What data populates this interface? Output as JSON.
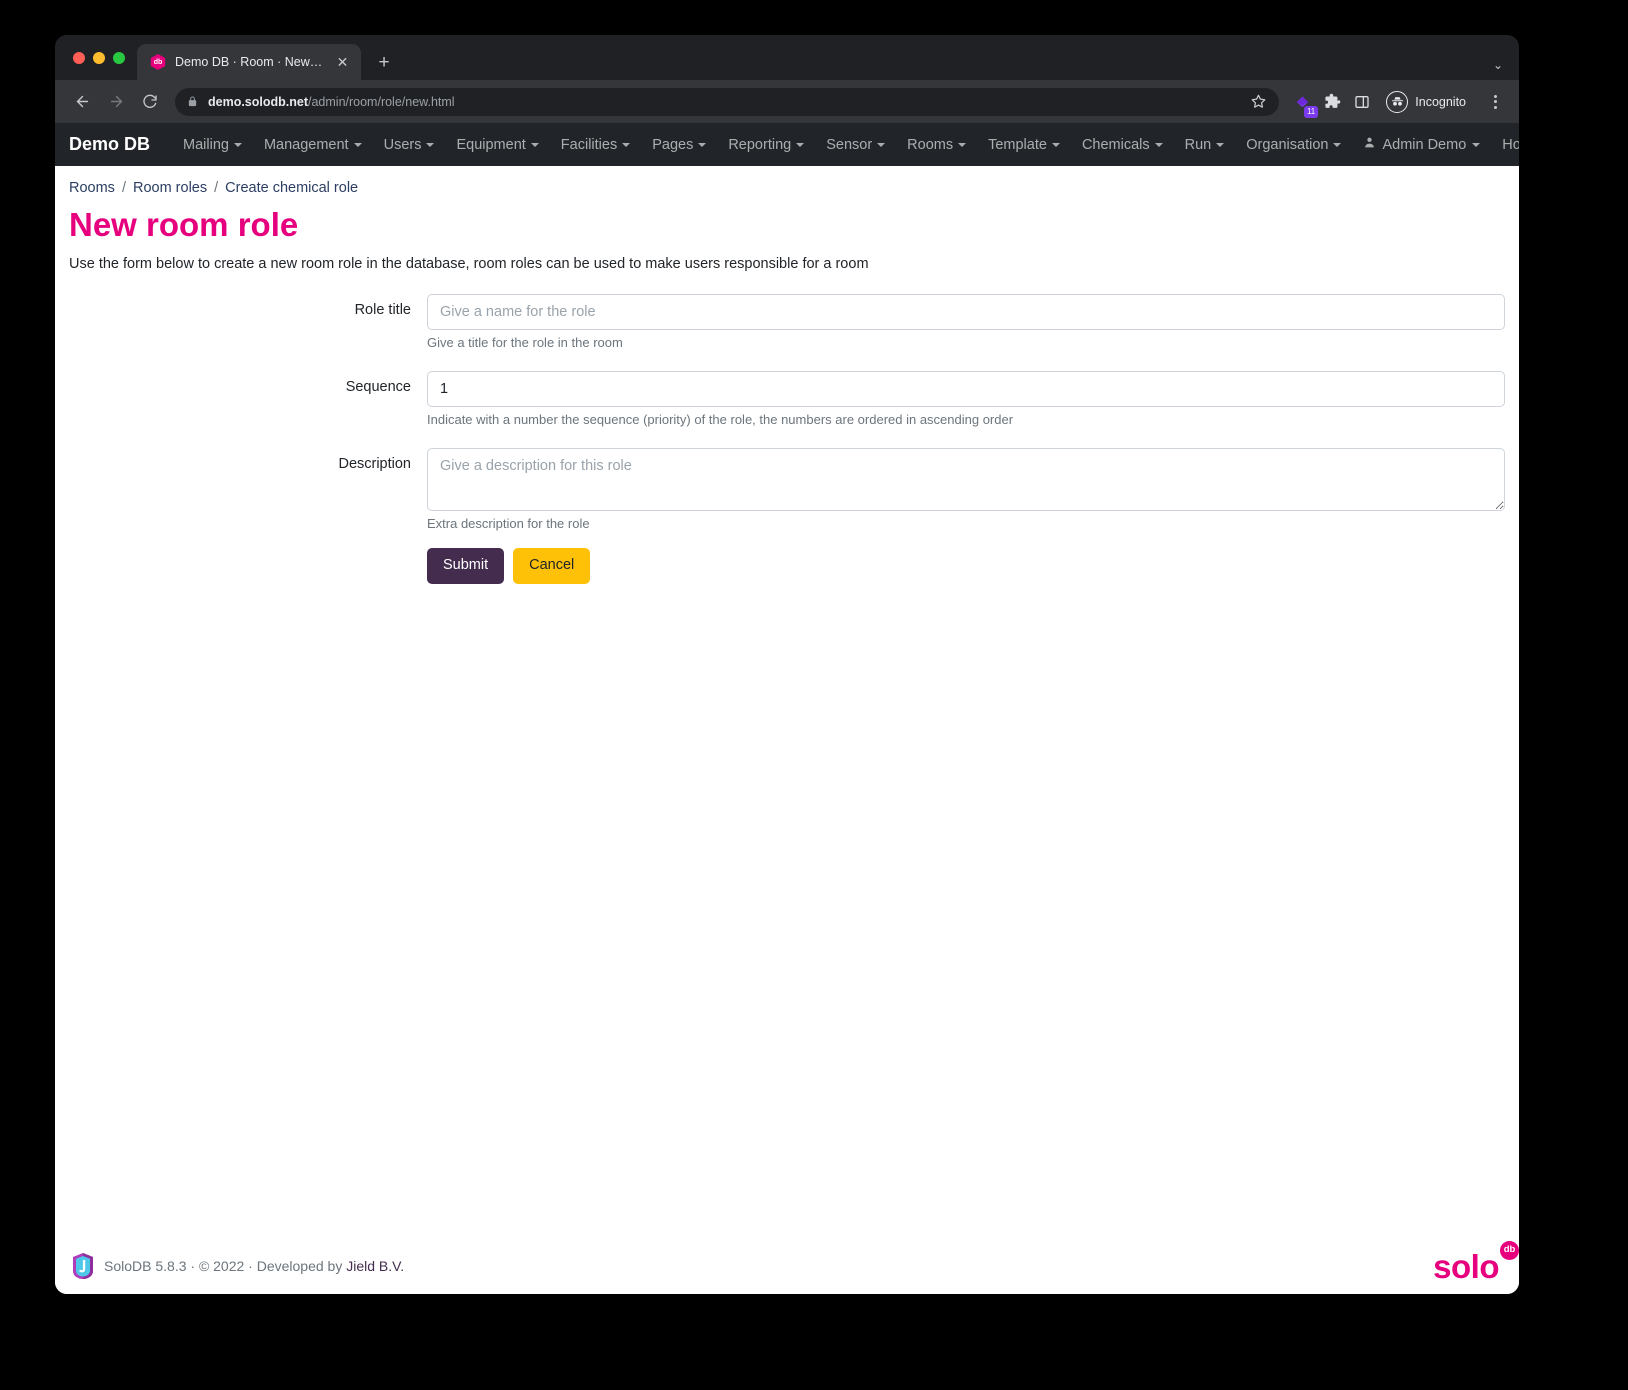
{
  "browser": {
    "tab": {
      "title": "Demo DB · Room · New role",
      "favicon_label": "db",
      "close_label": "✕"
    },
    "new_tab_label": "+",
    "tabstrip_chevron": "⌄",
    "address": {
      "domain": "demo.solodb.net",
      "path": "/admin/room/role/new.html",
      "lock_icon": "lock-icon",
      "star_icon": "bookmark-star-icon"
    },
    "extensions": {
      "badge_count": "11"
    },
    "profile_label": "Incognito",
    "menu_label": "⋮"
  },
  "navbar": {
    "brand": "Demo DB",
    "items": [
      {
        "label": "Mailing",
        "has_caret": true
      },
      {
        "label": "Management",
        "has_caret": true
      },
      {
        "label": "Users",
        "has_caret": true
      },
      {
        "label": "Equipment",
        "has_caret": true
      },
      {
        "label": "Facilities",
        "has_caret": true
      },
      {
        "label": "Pages",
        "has_caret": true
      },
      {
        "label": "Reporting",
        "has_caret": true
      },
      {
        "label": "Sensor",
        "has_caret": true
      },
      {
        "label": "Rooms",
        "has_caret": true
      },
      {
        "label": "Template",
        "has_caret": true
      },
      {
        "label": "Chemicals",
        "has_caret": true
      },
      {
        "label": "Run",
        "has_caret": true
      },
      {
        "label": "Organisation",
        "has_caret": true
      }
    ],
    "user": "Admin Demo",
    "home": "Home"
  },
  "breadcrumb": {
    "items": [
      "Rooms",
      "Room roles",
      "Create chemical role"
    ],
    "separator": "/"
  },
  "page": {
    "title": "New room role",
    "lead": "Use the form below to create a new room role in the database, room roles can be used to make users responsible for a room"
  },
  "form": {
    "fields": [
      {
        "label": "Role title",
        "name": "role-title",
        "type": "text",
        "value": "",
        "placeholder": "Give a name for the role",
        "help": "Give a title for the role in the room"
      },
      {
        "label": "Sequence",
        "name": "sequence",
        "type": "text",
        "value": "1",
        "placeholder": "",
        "help": "Indicate with a number the sequence (priority) of the role, the numbers are ordered in ascending order"
      },
      {
        "label": "Description",
        "name": "description",
        "type": "textarea",
        "value": "",
        "placeholder": "Give a description for this role",
        "help": "Extra description for the role"
      }
    ],
    "submit_label": "Submit",
    "cancel_label": "Cancel"
  },
  "footer": {
    "text_before": "SoloDB 5.8.3 · © 2022 · Developed by ",
    "link": "Jield B.V.",
    "logo_text": "solo",
    "logo_badge": "db"
  },
  "colors": {
    "accent_pink": "#e6007e",
    "navbar_bg": "#212529",
    "submit_purple": "#432c4e",
    "cancel_amber": "#ffc107",
    "link_navy": "#2c3e63"
  }
}
